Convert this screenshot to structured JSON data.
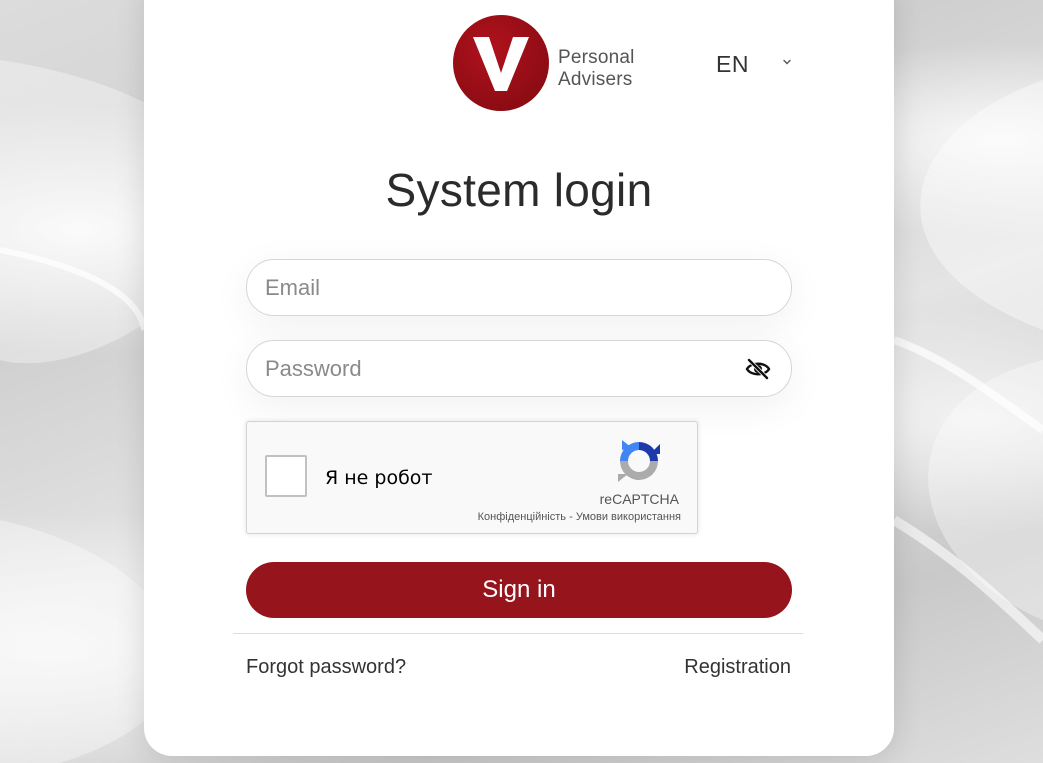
{
  "brand": {
    "logo_letter": "V",
    "name_line1": "Personal",
    "name_line2": "Advisers",
    "accent_color": "#96141c"
  },
  "language": {
    "selected": "EN",
    "icon": "chevron-down-icon"
  },
  "login": {
    "title": "System login",
    "email_placeholder": "Email",
    "password_placeholder": "Password",
    "password_toggle_icon": "eye-slash-icon",
    "signin_label": "Sign in",
    "forgot_label": "Forgot password?",
    "register_label": "Registration"
  },
  "recaptcha": {
    "checkbox_label": "Я не робот",
    "brand": "reCAPTCHA",
    "privacy_label": "Конфіденційність",
    "separator": "-",
    "terms_label": "Умови використання"
  }
}
